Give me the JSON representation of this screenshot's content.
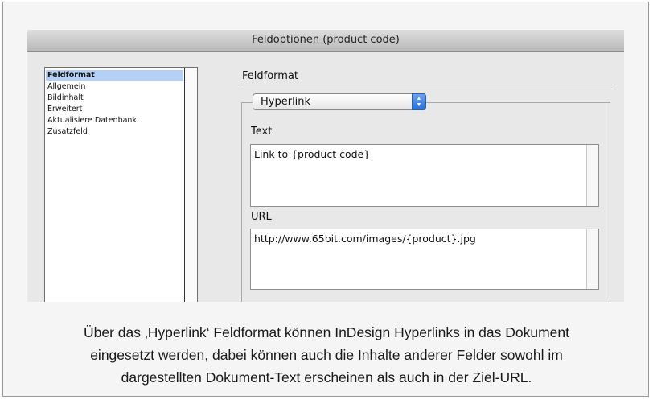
{
  "dialog": {
    "title": "Feldoptionen (product code)",
    "list_items": [
      {
        "label": "Feldformat",
        "selected": true
      },
      {
        "label": "Allgemein",
        "selected": false
      },
      {
        "label": "Bildinhalt",
        "selected": false
      },
      {
        "label": "Erweitert",
        "selected": false
      },
      {
        "label": "Aktualisiere Datenbank",
        "selected": false
      },
      {
        "label": "Zusatzfeld",
        "selected": false
      }
    ],
    "section_header": "Feldformat",
    "format_select": {
      "value": "Hyperlink"
    },
    "text_field": {
      "label": "Text",
      "value": "Link to {product code}"
    },
    "url_field": {
      "label": "URL",
      "value": "http://www.65bit.com/images/{product}.jpg"
    }
  },
  "caption": {
    "line1": "Über das ‚Hyperlink‘ Feldformat können InDesign Hyperlinks in das Dokument",
    "line2": "eingesetzt werden, dabei können auch die Inhalte anderer Felder sowohl im",
    "line3": "dargestellten Dokument-Text erscheinen als auch in der Ziel-URL."
  },
  "colors": {
    "selection": "#b5d0f5",
    "popup_accent": "#2a6fd6"
  },
  "icons": {
    "popup_arrows": "up-down-arrows-icon"
  }
}
